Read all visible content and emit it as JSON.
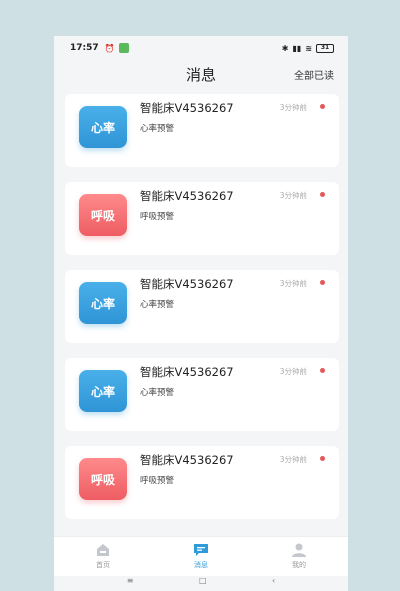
{
  "status_bar": {
    "time": "17:57",
    "alarm_icon": "alarm-icon",
    "battery": "31",
    "icons": [
      "bluetooth-icon",
      "signal-icon",
      "wifi-icon",
      "battery-icon"
    ]
  },
  "header": {
    "title": "消息",
    "mark_all_read": "全部已读"
  },
  "messages": [
    {
      "badge": "心率",
      "type": "heart",
      "device": "智能床V4536267",
      "alert": "心率预警",
      "time": "3分钟前"
    },
    {
      "badge": "呼吸",
      "type": "breath",
      "device": "智能床V4536267",
      "alert": "呼吸预警",
      "time": "3分钟前"
    },
    {
      "badge": "心率",
      "type": "heart",
      "device": "智能床V4536267",
      "alert": "心率预警",
      "time": "3分钟前"
    },
    {
      "badge": "心率",
      "type": "heart",
      "device": "智能床V4536267",
      "alert": "心率预警",
      "time": "3分钟前"
    },
    {
      "badge": "呼吸",
      "type": "breath",
      "device": "智能床V4536267",
      "alert": "呼吸预警",
      "time": "3分钟前"
    }
  ],
  "tabs": [
    {
      "label": "首页",
      "icon": "home-icon"
    },
    {
      "label": "消息",
      "icon": "message-icon",
      "active": true
    },
    {
      "label": "我的",
      "icon": "user-icon"
    }
  ],
  "colors": {
    "heart": "#2f94d6",
    "breath": "#ee5d63",
    "unread_dot": "#e25a5a",
    "active_tab": "#2f9bd8"
  }
}
